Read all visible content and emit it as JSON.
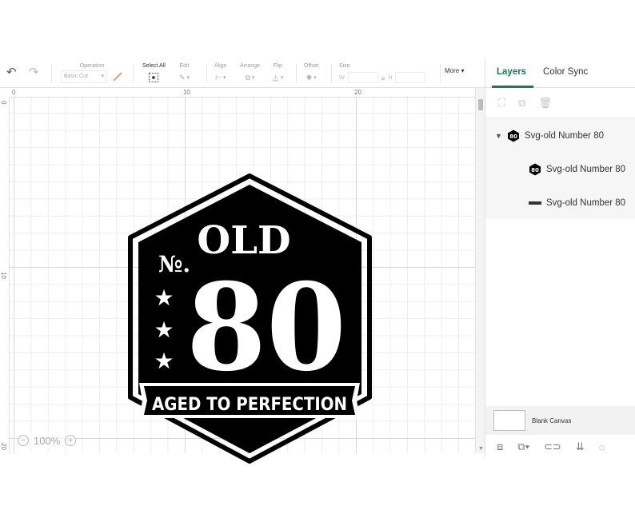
{
  "toolbar": {
    "undo_icon": "undo-icon",
    "redo_icon": "redo-icon",
    "operation_label": "Operation",
    "operation_value": "Basic Cut",
    "select_all_label": "Select All",
    "edit_label": "Edit",
    "align_label": "Align",
    "arrange_label": "Arrange",
    "flip_label": "Flip",
    "offset_label": "Offset",
    "size_label": "Size",
    "width_label": "W",
    "height_label": "H",
    "more_label": "More"
  },
  "ruler": {
    "top_ticks": [
      "0",
      "10",
      "20"
    ],
    "left_ticks": [
      "0",
      "10",
      "20"
    ]
  },
  "canvas": {
    "zoom": "100%",
    "zoom_out": "−",
    "zoom_in": "+"
  },
  "design": {
    "old": "OLD",
    "no": "№.",
    "number": "80",
    "banner": "AGED TO PERFECTION",
    "star": "★"
  },
  "panel": {
    "tab_layers": "Layers",
    "tab_color_sync": "Color Sync",
    "layers": [
      {
        "name": "Svg-old Number 80"
      },
      {
        "name": "Svg-old Number 80"
      },
      {
        "name": "Svg-old Number 80"
      }
    ],
    "blank_canvas": "Blank Canvas"
  },
  "colors": {
    "accent": "#1a7a5a",
    "design": "#000000"
  }
}
